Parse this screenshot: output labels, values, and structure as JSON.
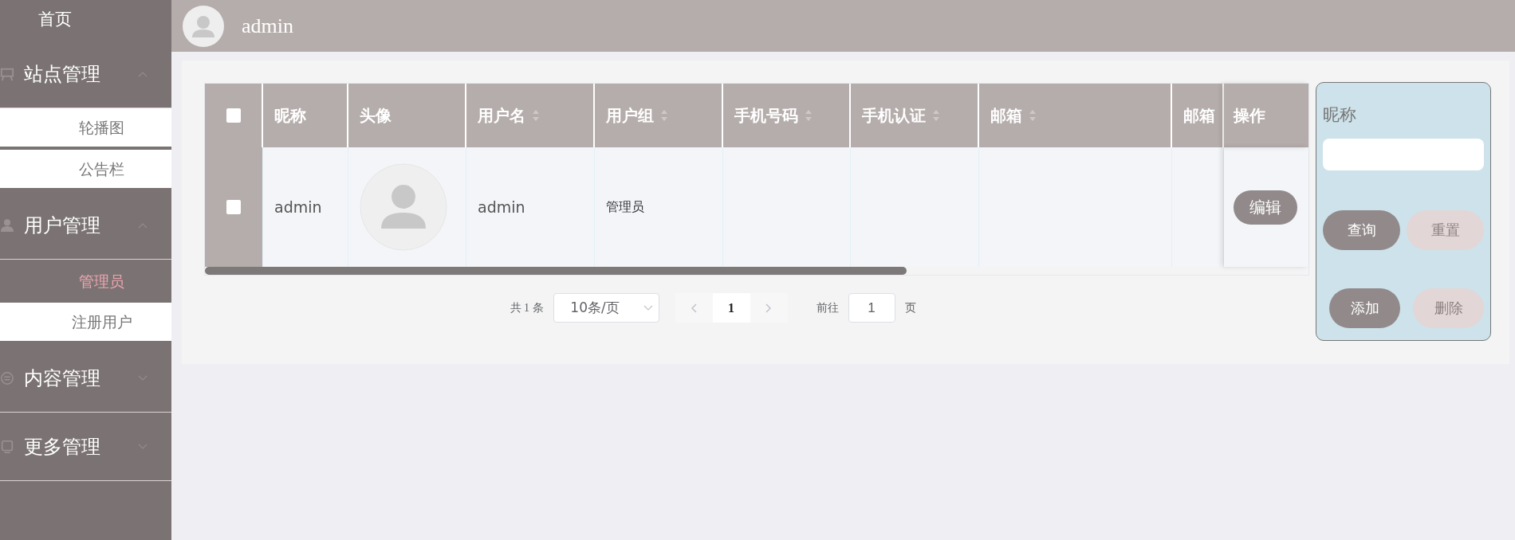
{
  "sidebar": {
    "items": [
      {
        "kind": "link",
        "label": "首页"
      },
      {
        "kind": "group",
        "label": "站点管理",
        "expanded": true,
        "children": [
          {
            "label": "轮播图",
            "selected": false
          },
          {
            "label": "公告栏",
            "selected": false
          }
        ]
      },
      {
        "kind": "group",
        "label": "用户管理",
        "expanded": true,
        "children": [
          {
            "label": "管理员",
            "selected": true
          },
          {
            "label": "注册用户",
            "selected": false
          }
        ]
      },
      {
        "kind": "group",
        "label": "内容管理",
        "expanded": false
      },
      {
        "kind": "group",
        "label": "更多管理",
        "expanded": false
      }
    ]
  },
  "header": {
    "username": "admin"
  },
  "table": {
    "header_checkbox": {
      "checked": false
    },
    "columns": [
      {
        "label": "昵称",
        "sortable": false
      },
      {
        "label": "头像",
        "sortable": false
      },
      {
        "label": "用户名",
        "sortable": true
      },
      {
        "label": "用户组",
        "sortable": true
      },
      {
        "label": "手机号码",
        "sortable": true
      },
      {
        "label": "手机认证",
        "sortable": true
      },
      {
        "label": "邮箱",
        "sortable": true
      },
      {
        "label": "邮箱"
      },
      {
        "label": "操作",
        "sortable": false
      }
    ],
    "rows": [
      {
        "checked": false,
        "nickname": "admin",
        "username": "admin",
        "group": "管理员",
        "actions": [
          "编辑"
        ]
      }
    ]
  },
  "pagination": {
    "total": "共 1 条",
    "page_size": "10条/页",
    "pages": [
      {
        "label": "1",
        "selected": true
      }
    ],
    "goto_label": "前往",
    "goto_value": "1",
    "goto_suffix": "页"
  },
  "search_panel": {
    "field_label": "昵称",
    "buttons": [
      {
        "label": "查询",
        "kind": "primary"
      },
      {
        "label": "重置",
        "kind": "secondary"
      },
      {
        "label": "添加",
        "kind": "primary"
      },
      {
        "label": "删除",
        "kind": "secondary"
      }
    ]
  }
}
